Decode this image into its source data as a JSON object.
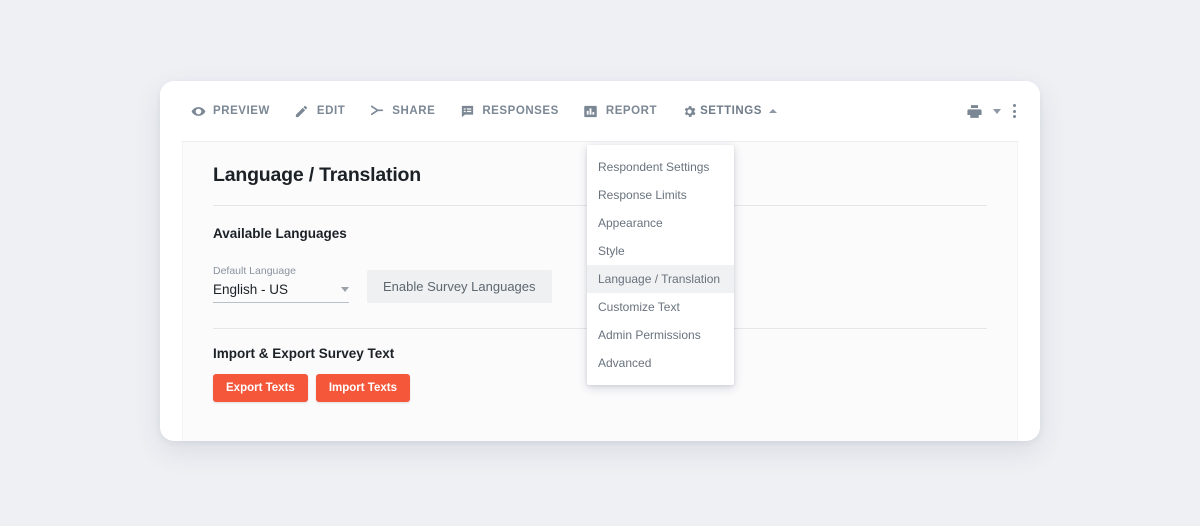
{
  "toolbar": {
    "nav": [
      {
        "label": "PREVIEW",
        "icon": "eye-icon"
      },
      {
        "label": "EDIT",
        "icon": "pencil-icon"
      },
      {
        "label": "SHARE",
        "icon": "share-arrow-icon"
      },
      {
        "label": "RESPONSES",
        "icon": "responses-list-icon"
      },
      {
        "label": "REPORT",
        "icon": "bar-chart-icon"
      },
      {
        "label": "SETTINGS",
        "icon": "gear-icon"
      }
    ],
    "print_icon": "printer-icon",
    "print_caret_icon": "chevron-down-icon",
    "more_icon": "kebab-menu-icon"
  },
  "settings_menu": {
    "items": [
      {
        "label": "Respondent Settings",
        "active": false
      },
      {
        "label": "Response Limits",
        "active": false
      },
      {
        "label": "Appearance",
        "active": false
      },
      {
        "label": "Style",
        "active": false
      },
      {
        "label": "Language / Translation",
        "active": true
      },
      {
        "label": "Customize Text",
        "active": false
      },
      {
        "label": "Admin Permissions",
        "active": false
      },
      {
        "label": "Advanced",
        "active": false
      }
    ]
  },
  "content": {
    "page_title": "Language / Translation",
    "available_languages_title": "Available Languages",
    "default_language_label": "Default Language",
    "default_language_value": "English - US",
    "enable_languages_label": "Enable Survey Languages",
    "import_export_title": "Import & Export Survey Text",
    "export_button": "Export Texts",
    "import_button": "Import Texts"
  },
  "colors": {
    "page_background": "#eef0f4",
    "card_background": "#ffffff",
    "panel_background": "#fbfbfc",
    "primary_action": "#f4573a",
    "nav_text": "#7b8794",
    "menu_text": "#69737e",
    "menu_active_background": "#f0f1f3",
    "heading_text": "#1c2126"
  }
}
